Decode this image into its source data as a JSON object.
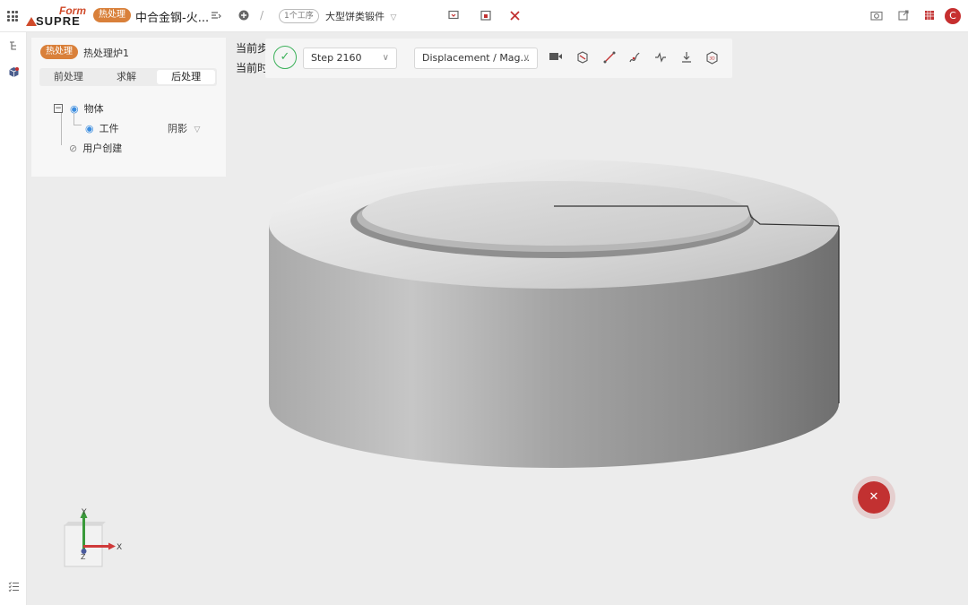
{
  "header": {
    "logo_small": "Form",
    "logo_main": "SUPRE",
    "mode_badge": "热处理",
    "project_title": "中合金钢-火...",
    "step_pill": "1个工序",
    "product_title": "大型饼类锻件",
    "avatar_initial": "C"
  },
  "panel": {
    "badge": "热处理",
    "furnace_name": "热处理炉1",
    "tabs": [
      "前处理",
      "求解",
      "后处理"
    ],
    "active_tab": "后处理",
    "tree": {
      "root_label": "物体",
      "child_label": "工件",
      "child_shading": "阴影",
      "user_label": "用户创建"
    }
  },
  "canvas": {
    "current_step_label": "当前步",
    "current_time_label": "当前时"
  },
  "toolbar": {
    "step_select": "Step 2160",
    "field_select": "Displacement / Mag..."
  },
  "axes": {
    "x": "X",
    "y": "Y",
    "z": "Z"
  },
  "colors": {
    "accent": "#c23131",
    "badge": "#d9803a",
    "ok": "#3cb15a"
  },
  "icons": [
    "grid-icon",
    "settings-list-icon",
    "add-circle-icon",
    "monitor-icon",
    "calendar-icon",
    "tools-icon",
    "camera-icon",
    "export-icon",
    "apps-icon",
    "tree-icon",
    "cube-icon",
    "checklist-icon",
    "check-icon",
    "video-icon",
    "section-icon",
    "line-icon",
    "curve-icon",
    "pulse-icon",
    "download-icon",
    "3d-view-icon",
    "wrench-icon"
  ]
}
